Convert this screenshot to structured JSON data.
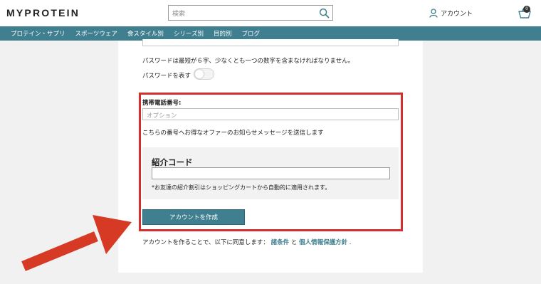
{
  "header": {
    "logo": "MYPROTEIN",
    "search_placeholder": "検索",
    "account_label": "アカウント",
    "cart_count": "0"
  },
  "nav": {
    "items": [
      "プロテイン・サプリ",
      "スポーツウェア",
      "食スタイル別",
      "シリーズ別",
      "目的別",
      "ブログ"
    ]
  },
  "form": {
    "password_hint": "パスワードは最短が６字、少なくとも一つの数字を含まなければなりません。",
    "show_password_label": "パスワードを表す",
    "phone_label": "携帯電話番号:",
    "phone_placeholder": "オプション",
    "phone_note": "こちらの番号へお得なオファーのお知らせメッセージを送信します",
    "referral_title": "紹介コード",
    "referral_note": "*お友達の紹介割引はショッピングカートから自動的に適用されます。",
    "create_button": "アカウントを作成",
    "terms_prefix": "アカウントを作ることで、以下に同意します：",
    "terms_link": "諸条件",
    "terms_and": "と",
    "privacy_link": "個人情報保護方針",
    "terms_suffix": "."
  },
  "colors": {
    "brand": "#3f7f8f",
    "highlight": "#d32f2f",
    "arrow": "#d63a25"
  },
  "icons": [
    "search-icon",
    "user-icon",
    "cart-icon",
    "arrow-annotation"
  ]
}
